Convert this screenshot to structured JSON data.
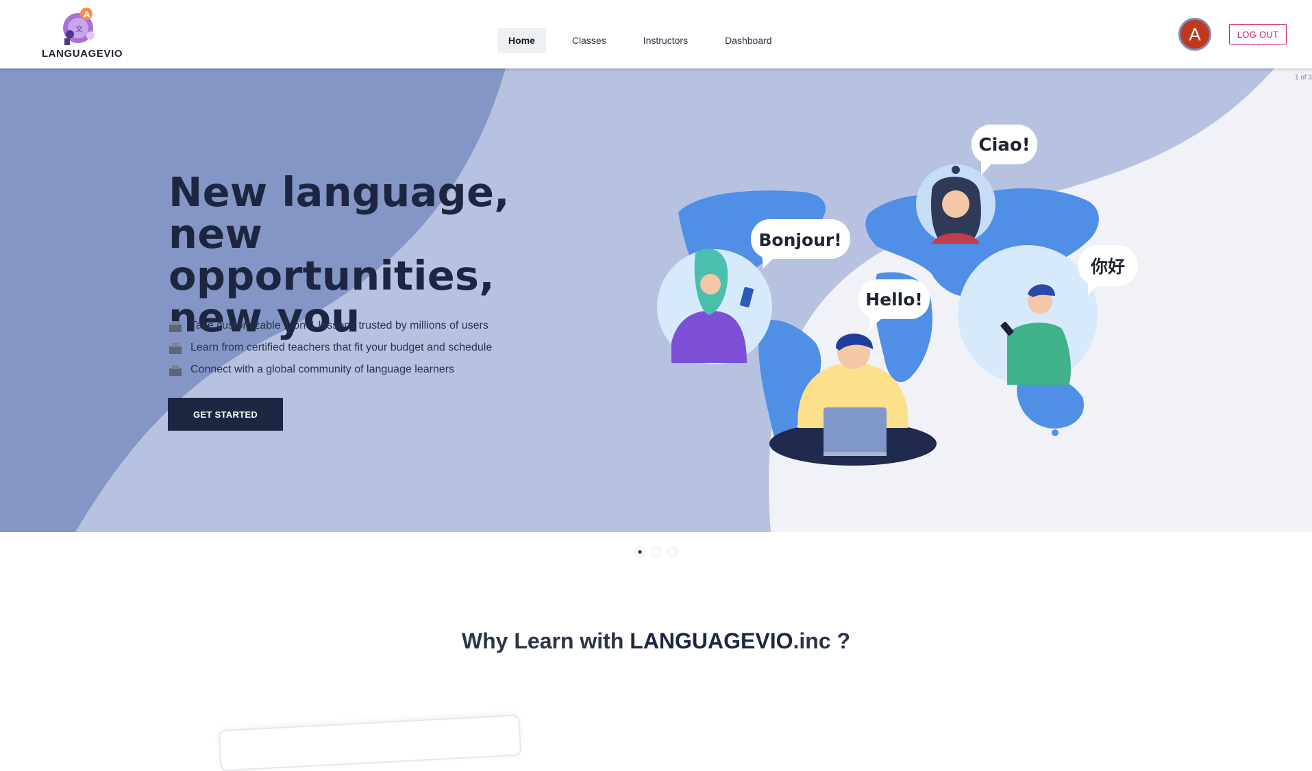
{
  "brand": {
    "name": "LANGUAGEVIO"
  },
  "nav": {
    "items": [
      {
        "label": "Home",
        "active": true
      },
      {
        "label": "Classes",
        "active": false
      },
      {
        "label": "Instructors",
        "active": false
      },
      {
        "label": "Dashboard",
        "active": false
      }
    ]
  },
  "user": {
    "avatar_initial": "A",
    "logout_label": "LOG OUT"
  },
  "hero": {
    "slide_counter": "1 of 3",
    "headline_lines": [
      "New language,",
      "new opportunities,",
      "new you"
    ],
    "features": [
      "Take customizable 1-on-1 lessons trusted by millions of users",
      "Learn from certified teachers that fit your budget and schedule",
      "Connect with a global community of language learners"
    ],
    "cta_label": "GET STARTED",
    "greetings": {
      "ciao": "Ciao!",
      "bonjour": "Bonjour!",
      "hello": "Hello!",
      "nihao": "你好"
    }
  },
  "carousel": {
    "slide_count": 3,
    "active_index": 0
  },
  "why": {
    "prefix": "Why Learn with ",
    "brand": "LANGUAGEVIO",
    "suffix": ".inc ?"
  },
  "colors": {
    "accent_dark": "#1d2640",
    "logout_pink": "#d01e6e",
    "avatar_red": "#c0391b",
    "hero_blue_dark": "#8396c6",
    "hero_blue_light": "#b7c2e0",
    "map_blue": "#4f8fe6"
  },
  "icons": {
    "logo": "language-globe-logo",
    "feature_bullet": "book-stack-icon"
  }
}
